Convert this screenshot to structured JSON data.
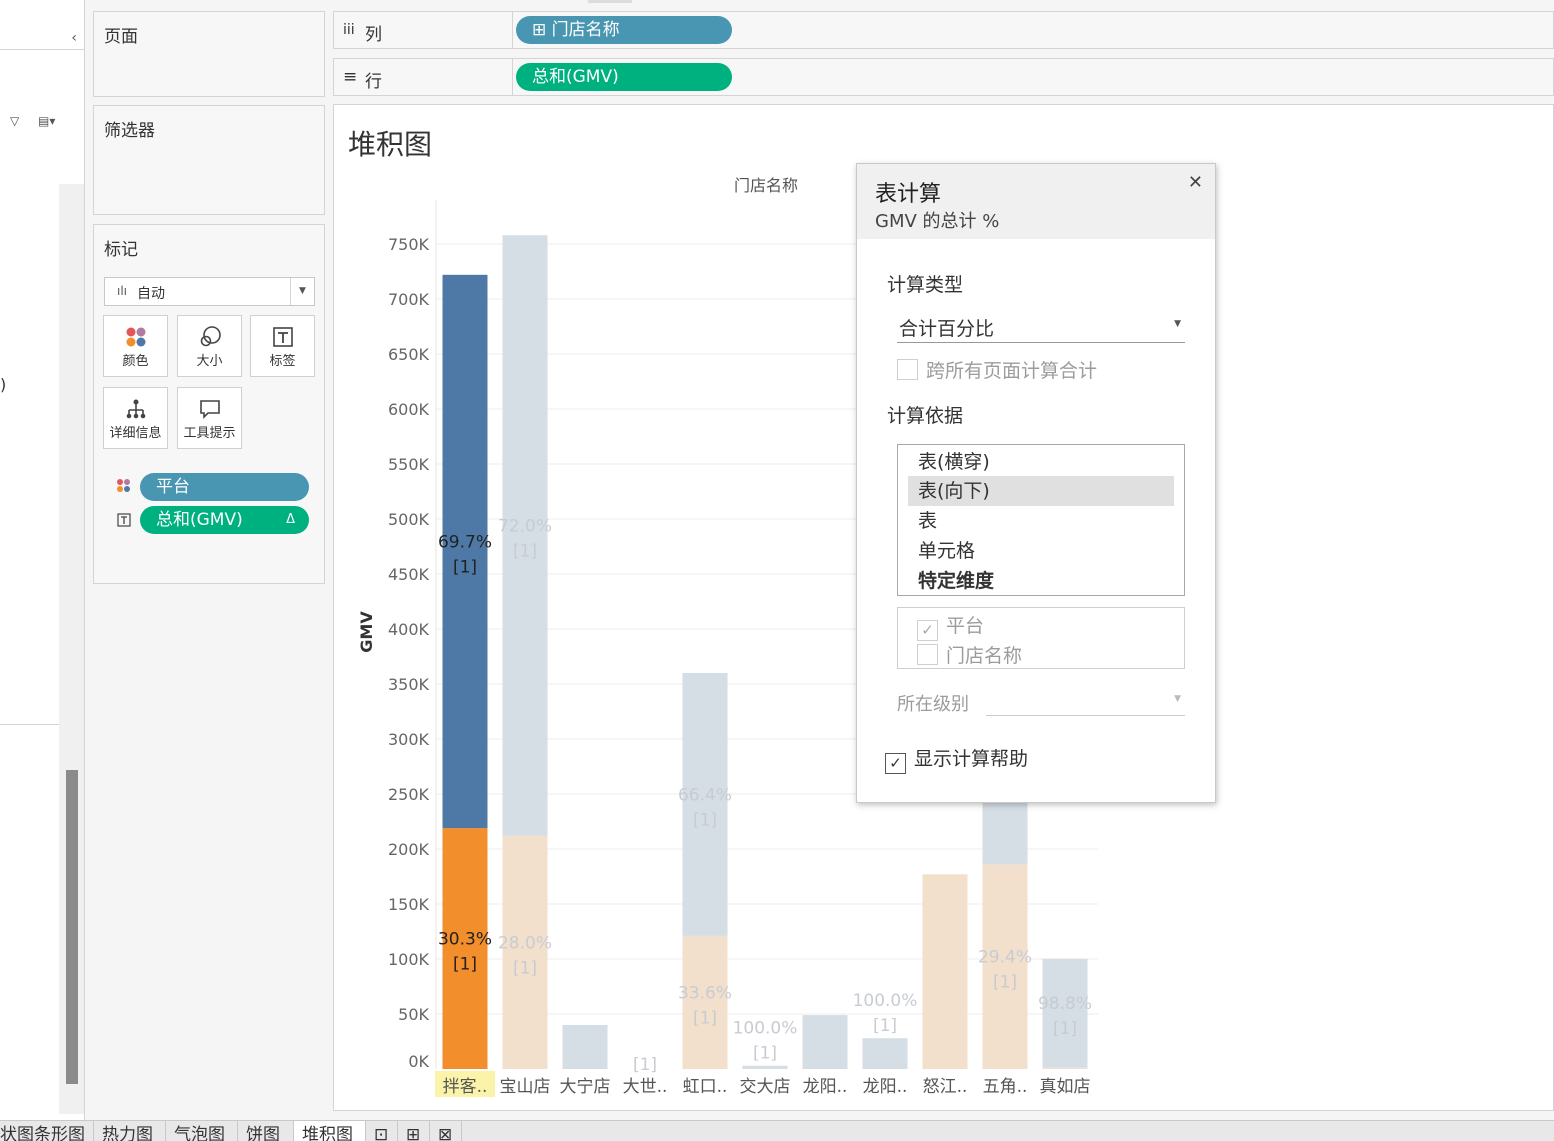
{
  "left_panel": {
    "collapse_glyph": "‹",
    "filter_glyph": "▽",
    "list_glyph": "▤▾",
    "paren_text": ")"
  },
  "pages_panel": {
    "title": "页面"
  },
  "filters_panel": {
    "title": "筛选器"
  },
  "marks_panel": {
    "title": "标记",
    "mark_type": {
      "icon": "bar-chart-icon",
      "label": "自动"
    },
    "buttons": [
      {
        "icon": "color-icon",
        "label": "颜色"
      },
      {
        "icon": "size-icon",
        "label": "大小"
      },
      {
        "icon": "label-icon",
        "label": "标签"
      },
      {
        "icon": "detail-icon",
        "label": "详细信息"
      },
      {
        "icon": "tooltip-icon",
        "label": "工具提示"
      }
    ],
    "pills": [
      {
        "icon": "color-dots-icon",
        "label": "平台",
        "color": "#4996b2"
      },
      {
        "icon": "text-icon",
        "label": "总和(GMV)",
        "color": "#00b180",
        "badge": "Δ"
      }
    ]
  },
  "shelves": {
    "columns": {
      "icon": "iii",
      "label": "列",
      "pill": "⊞ 门店名称"
    },
    "rows": {
      "icon": "≡",
      "label": "行",
      "pill": "总和(GMV)"
    }
  },
  "sheet": {
    "title": "堆积图"
  },
  "chart_data": {
    "type": "bar",
    "stacked": true,
    "header": "门店名称",
    "ylabel": "GMV",
    "ylim": [
      0,
      750000
    ],
    "yticks": [
      "0K",
      "50K",
      "100K",
      "150K",
      "200K",
      "250K",
      "300K",
      "350K",
      "400K",
      "450K",
      "500K",
      "550K",
      "600K",
      "650K",
      "700K",
      "750K"
    ],
    "categories": [
      "拌客..",
      "宝山店",
      "大宁店",
      "大世..",
      "虹口..",
      "交大店",
      "龙阳..",
      "龙阳..",
      "怒江..",
      "五角..",
      "真如店"
    ],
    "highlighted_category": "拌客..",
    "series": [
      {
        "color": "#f28e2b",
        "faded_color": "#f2dfcc",
        "values": [
          219000,
          212000,
          0,
          0,
          121000,
          0,
          0,
          0,
          177000,
          186000,
          1200
        ]
      },
      {
        "color": "#4e79a7",
        "faded_color": "#d5dde5",
        "values": [
          503000,
          546000,
          40000,
          0,
          239000,
          3000,
          49000,
          28000,
          0,
          446000,
          99000
        ]
      }
    ],
    "labels": [
      {
        "category": 0,
        "series": 1,
        "pct": "69.7%",
        "idx": "[1]",
        "strong": true
      },
      {
        "category": 0,
        "series": 0,
        "pct": "30.3%",
        "idx": "[1]",
        "strong": true
      },
      {
        "category": 1,
        "series": 1,
        "pct": "72.0%",
        "idx": "[1]"
      },
      {
        "category": 1,
        "series": 0,
        "pct": "28.0%",
        "idx": "[1]"
      },
      {
        "category": 3,
        "series": 1,
        "pct": "",
        "idx": "[1]"
      },
      {
        "category": 4,
        "series": 1,
        "pct": "66.4%",
        "idx": "[1]"
      },
      {
        "category": 4,
        "series": 0,
        "pct": "33.6%",
        "idx": "[1]"
      },
      {
        "category": 5,
        "series": 1,
        "pct": "100.0%",
        "idx": "[1]"
      },
      {
        "category": 7,
        "series": 1,
        "pct": "100.0%",
        "idx": "[1]"
      },
      {
        "category": 9,
        "series": 0,
        "pct": "29.4%",
        "idx": "[1]"
      },
      {
        "category": 10,
        "series": 1,
        "pct": "98.8%",
        "idx": "[1]"
      }
    ],
    "grid": true
  },
  "dialog": {
    "title": "表计算",
    "subtitle": "GMV 的总计 %",
    "close_glyph": "✕",
    "calc_type_label": "计算类型",
    "calc_type_value": "合计百分比",
    "across_pages_label": "跨所有页面计算合计",
    "compute_using_label": "计算依据",
    "compute_options": [
      "表(横穿)",
      "表(向下)",
      "表",
      "单元格",
      "特定维度"
    ],
    "selected_option": "表(向下)",
    "dimensions": [
      {
        "label": "平台",
        "checked": true
      },
      {
        "label": "门店名称",
        "checked": false
      }
    ],
    "level_label": "所在级别",
    "show_help_label": "显示计算帮助",
    "show_help_checked": true
  },
  "tabs": [
    {
      "label": "状图条形图",
      "active": false
    },
    {
      "label": "热力图",
      "active": false
    },
    {
      "label": "气泡图",
      "active": false
    },
    {
      "label": "饼图",
      "active": false
    },
    {
      "label": "堆积图",
      "active": true
    },
    {
      "label": "⊡",
      "active": false
    },
    {
      "label": "⊞",
      "active": false
    },
    {
      "label": "⊠",
      "active": false
    }
  ]
}
